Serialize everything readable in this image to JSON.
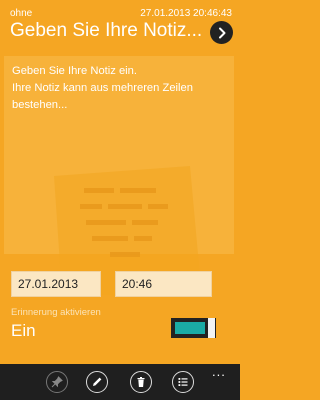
{
  "header": {
    "label": "ohne",
    "datetime": "27.01.2013 20:46:43",
    "title": "Geben Sie Ihre Notiz..."
  },
  "note": {
    "text": "Geben Sie Ihre Notiz ein.\nIhre Notiz kann aus mehreren Zeilen bestehen..."
  },
  "reminder": {
    "date": "27.01.2013",
    "time": "20:46",
    "label": "Erinnerung aktivieren",
    "state": "Ein",
    "enabled": true
  },
  "appbar": {
    "buttons": [
      {
        "icon": "pin-icon",
        "enabled": false
      },
      {
        "icon": "edit-icon",
        "enabled": true
      },
      {
        "icon": "delete-icon",
        "enabled": true
      },
      {
        "icon": "list-icon",
        "enabled": true
      }
    ],
    "more": "..."
  },
  "colors": {
    "background": "#f5a623",
    "note_panel": "#f7b23a",
    "field": "#fbe7c3",
    "toggle_accent": "#1aaba5",
    "appbar": "#1f1f1f"
  }
}
